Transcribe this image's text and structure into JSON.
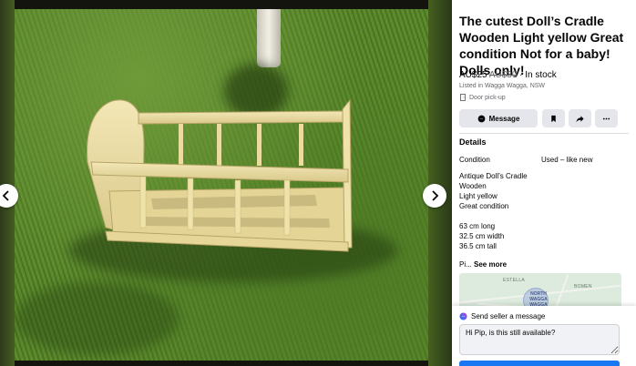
{
  "listing": {
    "title": "The cutest Doll’s Cradle Wooden Light yellow Great condition Not for a baby! Dolls only!",
    "price": "AU$25",
    "original_price": "AU$30",
    "stock_status": " · In stock",
    "listed_in": "Listed in Wagga Wagga, NSW",
    "pickup": "Door pick-up"
  },
  "actions": {
    "message_label": "Message",
    "save_icon": "bookmark-icon",
    "share_icon": "share-icon",
    "more_icon": "more-icon"
  },
  "details": {
    "heading": "Details",
    "condition_label": "Condition",
    "condition_value": "Used – like new",
    "description_lines": [
      "Antique Doll’s Cradle",
      "Wooden",
      "Light yellow",
      "Great condition"
    ],
    "dimension_lines": [
      "63 cm long",
      "32.5 cm width",
      "36.5 cm tall"
    ],
    "truncated_text": "Pi...",
    "see_more": "See more"
  },
  "map": {
    "labels": [
      "ESTELLA",
      "BOMEN",
      "NORTH WAGGA WAGGA"
    ]
  },
  "send": {
    "heading": "Send seller a message",
    "message_value": "Hi Pip, is this still available?"
  },
  "colors": {
    "accent": "#1877f2",
    "button_bg": "#e4e6eb",
    "text": "#050505",
    "secondary_text": "#65676b",
    "grass": "#5b8a2c",
    "wood": "#ecdca2"
  }
}
